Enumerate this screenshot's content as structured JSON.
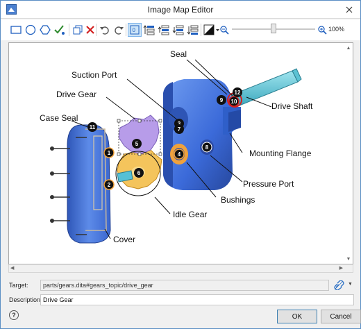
{
  "window": {
    "title": "Image Map Editor"
  },
  "toolbar": {
    "items": [
      {
        "name": "rectangle-tool-icon"
      },
      {
        "name": "ellipse-tool-icon"
      },
      {
        "name": "polygon-tool-icon"
      },
      {
        "name": "checkmark-edit-icon"
      },
      {
        "name": "duplicate-icon"
      },
      {
        "name": "delete-icon"
      },
      {
        "name": "undo-icon"
      },
      {
        "name": "redo-icon"
      },
      {
        "name": "show-area-numbers-icon"
      },
      {
        "name": "bring-to-front-icon"
      },
      {
        "name": "bring-forward-icon"
      },
      {
        "name": "send-backward-icon"
      },
      {
        "name": "send-to-back-icon"
      },
      {
        "name": "color-picker-icon"
      },
      {
        "name": "zoom-out-icon"
      },
      {
        "name": "zoom-in-icon"
      }
    ],
    "zoom_label": "100%",
    "zoom_level": 0.5
  },
  "image": {
    "labels": {
      "seal": "Seal",
      "suction_port": "Suction Port",
      "drive_gear": "Drive Gear",
      "case_seal": "Case Seal",
      "drive_shaft": "Drive Shaft",
      "mounting_flange": "Mounting Flange",
      "pressure_port": "Pressure Port",
      "bushings": "Bushings",
      "idle_gear": "Idle Gear",
      "cover": "Cover"
    },
    "area_numbers": [
      "1",
      "2",
      "3",
      "4",
      "5",
      "6",
      "7",
      "8",
      "9",
      "10",
      "11",
      "12"
    ]
  },
  "form": {
    "target_label": "Target:",
    "target_value": "parts/gears.dita#gears_topic/drive_gear",
    "description_label": "Description:",
    "description_value": "Drive Gear"
  },
  "buttons": {
    "ok": "OK",
    "cancel": "Cancel",
    "help": "?"
  },
  "colors": {
    "accent": "#0066cc",
    "pump_blue": "#3f74e0",
    "gear_purple": "#b49be8",
    "gear_yellow": "#f3c35a",
    "shaft_cyan": "#59c3d6",
    "selection_red": "#d42020"
  }
}
